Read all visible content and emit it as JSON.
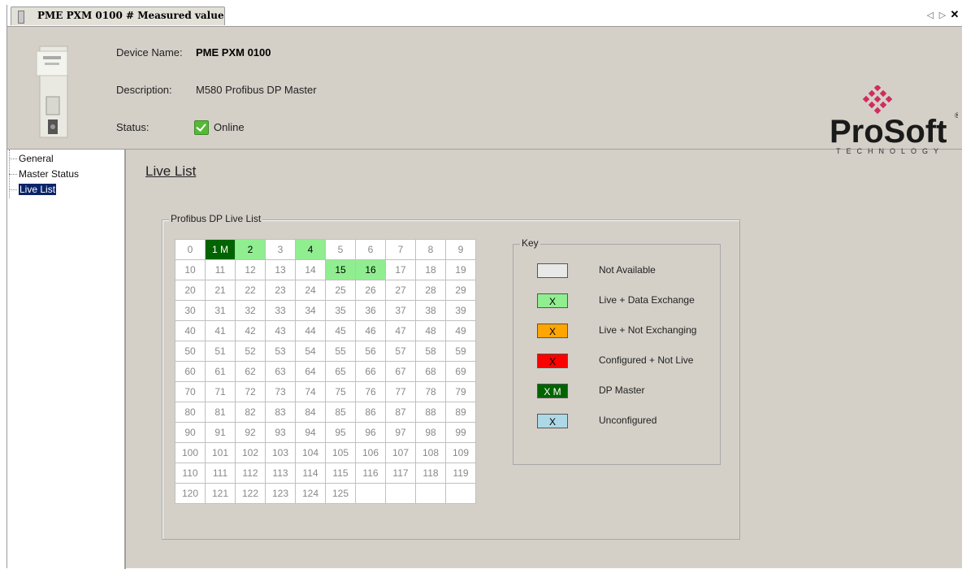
{
  "tab": {
    "title": "PME PXM 0100 # Measured value",
    "controls": [
      "◁",
      "▷",
      "✕"
    ]
  },
  "header": {
    "device_name_label": "Device Name:",
    "device_name": "PME PXM 0100",
    "description_label": "Description:",
    "description": "M580 Profibus DP Master",
    "status_label": "Status:",
    "status": "Online",
    "logo_text": "ProSoft",
    "logo_sub": "TECHNOLOGY",
    "logo_reg": "®"
  },
  "tree": {
    "items": [
      {
        "label": "General"
      },
      {
        "label": "Master Status"
      },
      {
        "label": "Live List"
      }
    ]
  },
  "main": {
    "title": "Live List",
    "group_label": "Profibus DP Live List",
    "grid_rows": [
      [
        {
          "t": "0",
          "s": "none"
        },
        {
          "t": "1 M",
          "s": "master"
        },
        {
          "t": "2",
          "s": "live"
        },
        {
          "t": "3",
          "s": "none"
        },
        {
          "t": "4",
          "s": "live"
        },
        {
          "t": "5",
          "s": "none"
        },
        {
          "t": "6",
          "s": "none"
        },
        {
          "t": "7",
          "s": "none"
        },
        {
          "t": "8",
          "s": "none"
        },
        {
          "t": "9",
          "s": "none"
        }
      ],
      [
        {
          "t": "10",
          "s": "none"
        },
        {
          "t": "11",
          "s": "none"
        },
        {
          "t": "12",
          "s": "none"
        },
        {
          "t": "13",
          "s": "none"
        },
        {
          "t": "14",
          "s": "none"
        },
        {
          "t": "15",
          "s": "live"
        },
        {
          "t": "16",
          "s": "live"
        },
        {
          "t": "17",
          "s": "none"
        },
        {
          "t": "18",
          "s": "none"
        },
        {
          "t": "19",
          "s": "none"
        }
      ],
      [
        {
          "t": "20",
          "s": "none"
        },
        {
          "t": "21",
          "s": "none"
        },
        {
          "t": "22",
          "s": "none"
        },
        {
          "t": "23",
          "s": "none"
        },
        {
          "t": "24",
          "s": "none"
        },
        {
          "t": "25",
          "s": "none"
        },
        {
          "t": "26",
          "s": "none"
        },
        {
          "t": "27",
          "s": "none"
        },
        {
          "t": "28",
          "s": "none"
        },
        {
          "t": "29",
          "s": "none"
        }
      ],
      [
        {
          "t": "30",
          "s": "none"
        },
        {
          "t": "31",
          "s": "none"
        },
        {
          "t": "32",
          "s": "none"
        },
        {
          "t": "33",
          "s": "none"
        },
        {
          "t": "34",
          "s": "none"
        },
        {
          "t": "35",
          "s": "none"
        },
        {
          "t": "36",
          "s": "none"
        },
        {
          "t": "37",
          "s": "none"
        },
        {
          "t": "38",
          "s": "none"
        },
        {
          "t": "39",
          "s": "none"
        }
      ],
      [
        {
          "t": "40",
          "s": "none"
        },
        {
          "t": "41",
          "s": "none"
        },
        {
          "t": "42",
          "s": "none"
        },
        {
          "t": "43",
          "s": "none"
        },
        {
          "t": "44",
          "s": "none"
        },
        {
          "t": "45",
          "s": "none"
        },
        {
          "t": "46",
          "s": "none"
        },
        {
          "t": "47",
          "s": "none"
        },
        {
          "t": "48",
          "s": "none"
        },
        {
          "t": "49",
          "s": "none"
        }
      ],
      [
        {
          "t": "50",
          "s": "none"
        },
        {
          "t": "51",
          "s": "none"
        },
        {
          "t": "52",
          "s": "none"
        },
        {
          "t": "53",
          "s": "none"
        },
        {
          "t": "54",
          "s": "none"
        },
        {
          "t": "55",
          "s": "none"
        },
        {
          "t": "56",
          "s": "none"
        },
        {
          "t": "57",
          "s": "none"
        },
        {
          "t": "58",
          "s": "none"
        },
        {
          "t": "59",
          "s": "none"
        }
      ],
      [
        {
          "t": "60",
          "s": "none"
        },
        {
          "t": "61",
          "s": "none"
        },
        {
          "t": "62",
          "s": "none"
        },
        {
          "t": "63",
          "s": "none"
        },
        {
          "t": "64",
          "s": "none"
        },
        {
          "t": "65",
          "s": "none"
        },
        {
          "t": "66",
          "s": "none"
        },
        {
          "t": "67",
          "s": "none"
        },
        {
          "t": "68",
          "s": "none"
        },
        {
          "t": "69",
          "s": "none"
        }
      ],
      [
        {
          "t": "70",
          "s": "none"
        },
        {
          "t": "71",
          "s": "none"
        },
        {
          "t": "72",
          "s": "none"
        },
        {
          "t": "73",
          "s": "none"
        },
        {
          "t": "74",
          "s": "none"
        },
        {
          "t": "75",
          "s": "none"
        },
        {
          "t": "76",
          "s": "none"
        },
        {
          "t": "77",
          "s": "none"
        },
        {
          "t": "78",
          "s": "none"
        },
        {
          "t": "79",
          "s": "none"
        }
      ],
      [
        {
          "t": "80",
          "s": "none"
        },
        {
          "t": "81",
          "s": "none"
        },
        {
          "t": "82",
          "s": "none"
        },
        {
          "t": "83",
          "s": "none"
        },
        {
          "t": "84",
          "s": "none"
        },
        {
          "t": "85",
          "s": "none"
        },
        {
          "t": "86",
          "s": "none"
        },
        {
          "t": "87",
          "s": "none"
        },
        {
          "t": "88",
          "s": "none"
        },
        {
          "t": "89",
          "s": "none"
        }
      ],
      [
        {
          "t": "90",
          "s": "none"
        },
        {
          "t": "91",
          "s": "none"
        },
        {
          "t": "92",
          "s": "none"
        },
        {
          "t": "93",
          "s": "none"
        },
        {
          "t": "94",
          "s": "none"
        },
        {
          "t": "95",
          "s": "none"
        },
        {
          "t": "96",
          "s": "none"
        },
        {
          "t": "97",
          "s": "none"
        },
        {
          "t": "98",
          "s": "none"
        },
        {
          "t": "99",
          "s": "none"
        }
      ],
      [
        {
          "t": "100",
          "s": "none"
        },
        {
          "t": "101",
          "s": "none"
        },
        {
          "t": "102",
          "s": "none"
        },
        {
          "t": "103",
          "s": "none"
        },
        {
          "t": "104",
          "s": "none"
        },
        {
          "t": "105",
          "s": "none"
        },
        {
          "t": "106",
          "s": "none"
        },
        {
          "t": "107",
          "s": "none"
        },
        {
          "t": "108",
          "s": "none"
        },
        {
          "t": "109",
          "s": "none"
        }
      ],
      [
        {
          "t": "110",
          "s": "none"
        },
        {
          "t": "111",
          "s": "none"
        },
        {
          "t": "112",
          "s": "none"
        },
        {
          "t": "113",
          "s": "none"
        },
        {
          "t": "114",
          "s": "none"
        },
        {
          "t": "115",
          "s": "none"
        },
        {
          "t": "116",
          "s": "none"
        },
        {
          "t": "117",
          "s": "none"
        },
        {
          "t": "118",
          "s": "none"
        },
        {
          "t": "119",
          "s": "none"
        }
      ],
      [
        {
          "t": "120",
          "s": "none"
        },
        {
          "t": "121",
          "s": "none"
        },
        {
          "t": "122",
          "s": "none"
        },
        {
          "t": "123",
          "s": "none"
        },
        {
          "t": "124",
          "s": "none"
        },
        {
          "t": "125",
          "s": "none"
        },
        {
          "t": "",
          "s": "empty"
        },
        {
          "t": "",
          "s": "empty"
        },
        {
          "t": "",
          "s": "empty"
        },
        {
          "t": "",
          "s": "empty"
        }
      ]
    ],
    "key": {
      "label": "Key",
      "items": [
        {
          "swatch": "",
          "color": "#e8e8e8",
          "text": "Not Available"
        },
        {
          "swatch": "X",
          "color": "#90ee90",
          "text": "Live + Data Exchange"
        },
        {
          "swatch": "X",
          "color": "#ffa500",
          "text": "Live + Not Exchanging"
        },
        {
          "swatch": "X",
          "color": "#ff0000",
          "text": "Configured + Not Live"
        },
        {
          "swatch": "X M",
          "color": "#006400",
          "text": "DP Master"
        },
        {
          "swatch": "X",
          "color": "#add8e6",
          "text": "Unconfigured"
        }
      ]
    }
  }
}
